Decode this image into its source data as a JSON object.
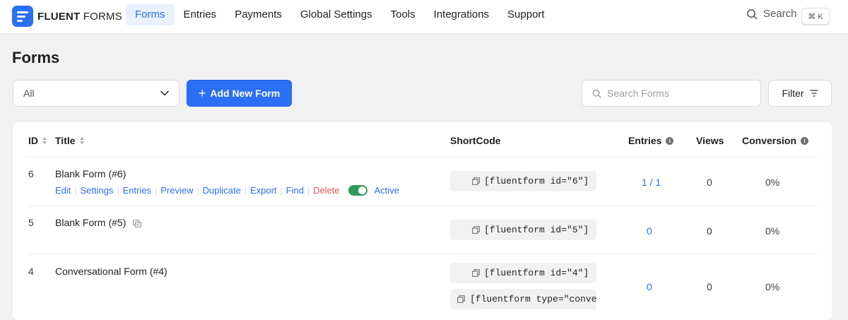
{
  "app": {
    "logo_text_bold": "FLUENT",
    "logo_text_light": "FORMS",
    "brand_color": "#2a6ff5"
  },
  "nav": {
    "items": [
      "Forms",
      "Entries",
      "Payments",
      "Global Settings",
      "Tools",
      "Integrations",
      "Support"
    ],
    "active": "Forms",
    "search_label": "Search",
    "search_shortcut": "⌘ K"
  },
  "page": {
    "title": "Forms"
  },
  "toolbar": {
    "filter_select_value": "All",
    "add_button_label": "Add New Form",
    "search_placeholder": "Search Forms",
    "filter_button_label": "Filter"
  },
  "table": {
    "columns": {
      "id": "ID",
      "title": "Title",
      "shortcode": "ShortCode",
      "entries": "Entries",
      "views": "Views",
      "conversion": "Conversion"
    },
    "row_actions": [
      "Edit",
      "Settings",
      "Entries",
      "Preview",
      "Duplicate",
      "Export",
      "Find",
      "Delete"
    ],
    "rows": [
      {
        "id": "6",
        "title": "Blank Form (#6)",
        "shortcodes": [
          "[fluentform id=\"6\"]"
        ],
        "entries": "1 / 1",
        "views": "0",
        "conversion": "0%",
        "status": "Active",
        "active": true
      },
      {
        "id": "5",
        "title": "Blank Form (#5)",
        "shortcodes": [
          "[fluentform id=\"5\"]"
        ],
        "entries": "0",
        "views": "0",
        "conversion": "0%"
      },
      {
        "id": "4",
        "title": "Conversational Form (#4)",
        "shortcodes": [
          "[fluentform id=\"4\"]",
          "[fluentform type=\"conve…"
        ],
        "entries": "0",
        "views": "0",
        "conversion": "0%"
      }
    ]
  }
}
